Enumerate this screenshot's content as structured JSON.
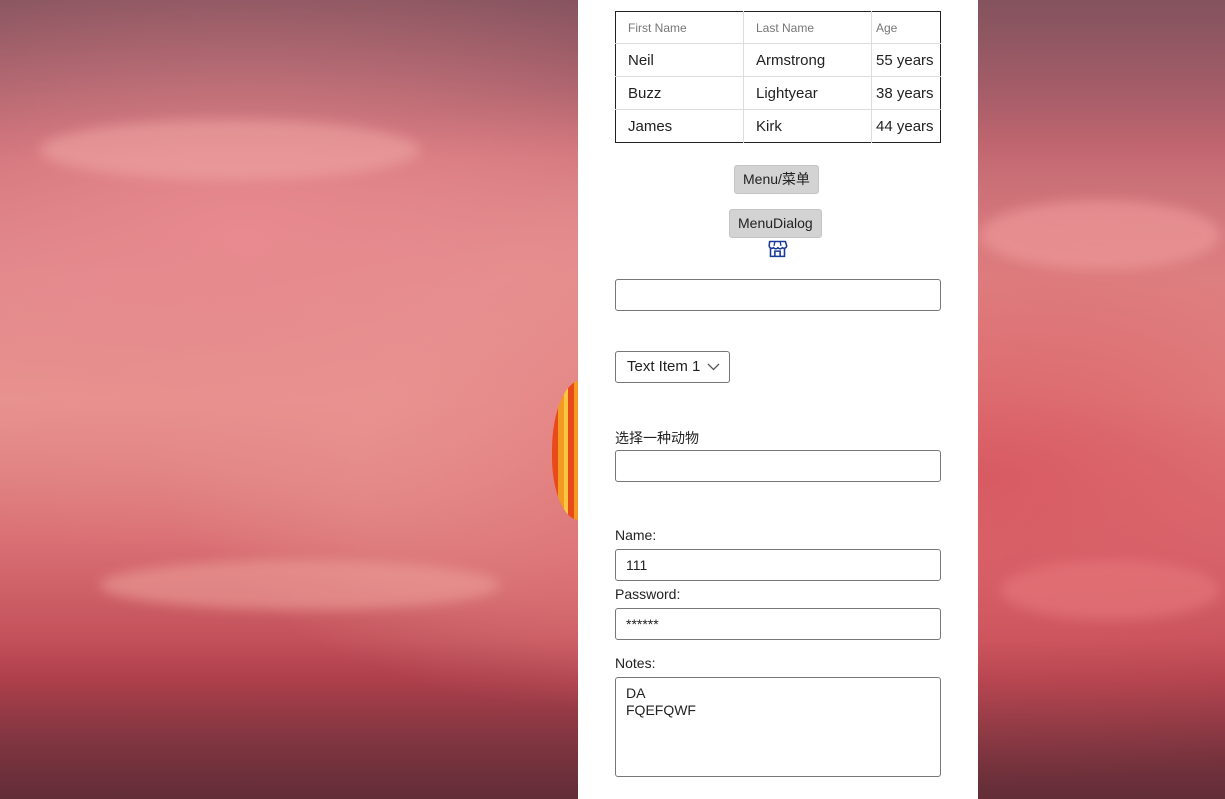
{
  "table": {
    "headers": [
      "First Name",
      "Last Name",
      "Age"
    ],
    "rows": [
      [
        "Neil",
        "Armstrong",
        "55 years"
      ],
      [
        "Buzz",
        "Lightyear",
        "38 years"
      ],
      [
        "James",
        "Kirk",
        "44 years"
      ]
    ]
  },
  "buttons": {
    "menu_label": "Menu/菜单",
    "menu_dialog_label": "MenuDialog"
  },
  "icons": {
    "store": "store-icon",
    "dropdown": "chevron-down-icon"
  },
  "text_input": {
    "value": ""
  },
  "dropdown": {
    "selected": "Text Item 1"
  },
  "animal": {
    "label": "选择一种动物",
    "value": ""
  },
  "form": {
    "name_label": "Name:",
    "name_value": "111",
    "password_label": "Password:",
    "password_value": "******",
    "notes_label": "Notes:",
    "notes_lines": [
      "DA",
      "FQEFQWF"
    ]
  },
  "colors": {
    "icon_blue": "#1a3a9a",
    "panel": "#ffffff"
  }
}
